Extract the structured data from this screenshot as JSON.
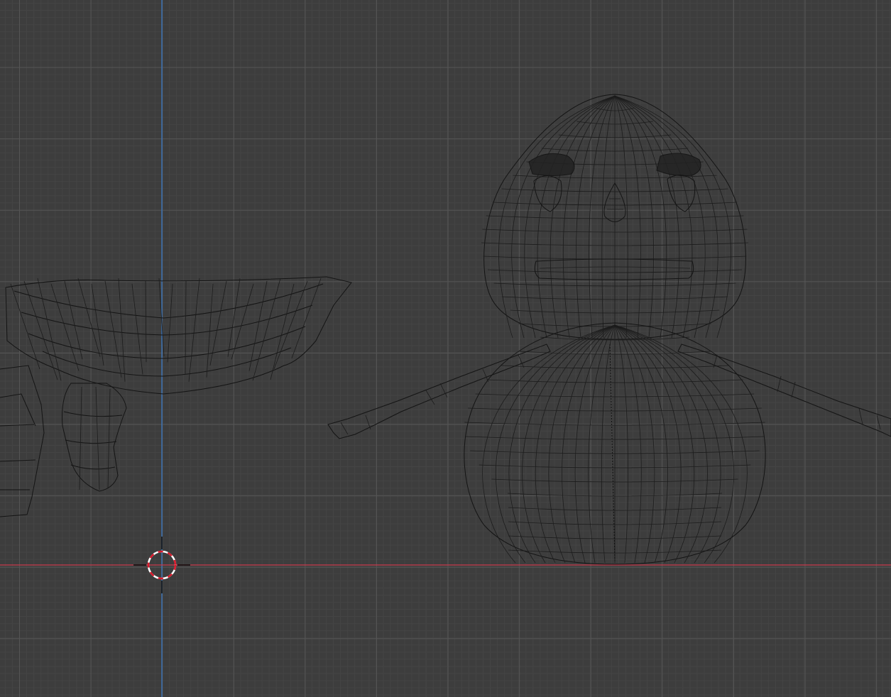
{
  "viewport": {
    "mode": "wireframe",
    "view": "front-orthographic",
    "colors": {
      "background": "#3d3d3d",
      "grid_major": "#555555",
      "grid_minor": "#444444",
      "x_axis": "#c7394c",
      "z_axis": "#3a78c2",
      "wire": "#141414",
      "cursor_red": "#d9182a",
      "cursor_white": "#ffffff"
    }
  },
  "objects": [
    {
      "name": "basket-mesh",
      "icon": "mesh-wireframe"
    },
    {
      "name": "snowman-mesh",
      "icon": "mesh-wireframe"
    }
  ],
  "cursor": {
    "icon": "3d-cursor-icon"
  }
}
